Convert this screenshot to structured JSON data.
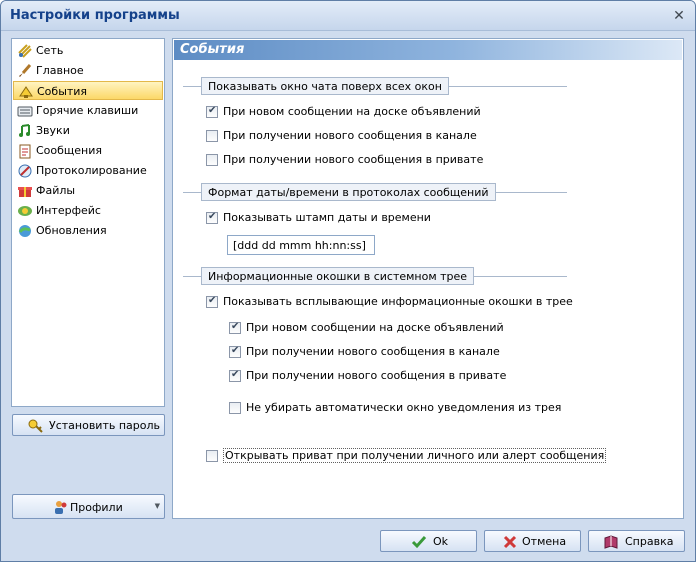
{
  "window": {
    "title": "Настройки программы",
    "close": "✕"
  },
  "sidebar": {
    "items": [
      {
        "label": "Сеть",
        "icon": "network-icon"
      },
      {
        "label": "Главное",
        "icon": "brush-icon"
      },
      {
        "label": "События",
        "icon": "events-icon",
        "selected": true
      },
      {
        "label": "Горячие клавиши",
        "icon": "keyboard-icon"
      },
      {
        "label": "Звуки",
        "icon": "music-note-icon"
      },
      {
        "label": "Сообщения",
        "icon": "clipboard-icon"
      },
      {
        "label": "Протоколирование",
        "icon": "pen-icon"
      },
      {
        "label": "Файлы",
        "icon": "gift-icon"
      },
      {
        "label": "Интерфейс",
        "icon": "interface-icon"
      },
      {
        "label": "Обновления",
        "icon": "update-icon"
      }
    ],
    "set_password_label": "Установить пароль",
    "profiles_label": "Профили"
  },
  "panel": {
    "title": "События",
    "group1": {
      "label": "Показывать окно чата поверх всех окон",
      "options": [
        {
          "label": "При новом сообщении на доске объявлений",
          "checked": true
        },
        {
          "label": "При получении нового сообщения в канале",
          "checked": false
        },
        {
          "label": "При получении нового сообщения в привате",
          "checked": false
        }
      ]
    },
    "group2": {
      "label": "Формат даты/времени в протоколах сообщений",
      "show_stamp": {
        "label": "Показывать штамп даты и времени",
        "checked": true
      },
      "format_value": "[ddd dd mmm hh:nn:ss]"
    },
    "group3": {
      "label": "Информационные окошки в системном трее",
      "show_popups": {
        "label": "Показывать всплывающие информационные окошки в трее",
        "checked": true
      },
      "options": [
        {
          "label": "При новом сообщении на доске объявлений",
          "checked": true
        },
        {
          "label": "При получении нового сообщения в канале",
          "checked": true
        },
        {
          "label": "При получении нового сообщения в привате",
          "checked": true
        }
      ],
      "no_auto_close": {
        "label": "Не убирать автоматически окно уведомления из трея",
        "checked": false
      }
    },
    "open_private": {
      "label": "Открывать приват при получении личного или алерт сообщения",
      "checked": false
    }
  },
  "buttons": {
    "ok": "Ok",
    "cancel": "Отмена",
    "help": "Справка"
  },
  "colors": {
    "selected_bg": "#fcd868",
    "header_start": "#5d8cc4",
    "window_bg": "#cfdcee"
  }
}
